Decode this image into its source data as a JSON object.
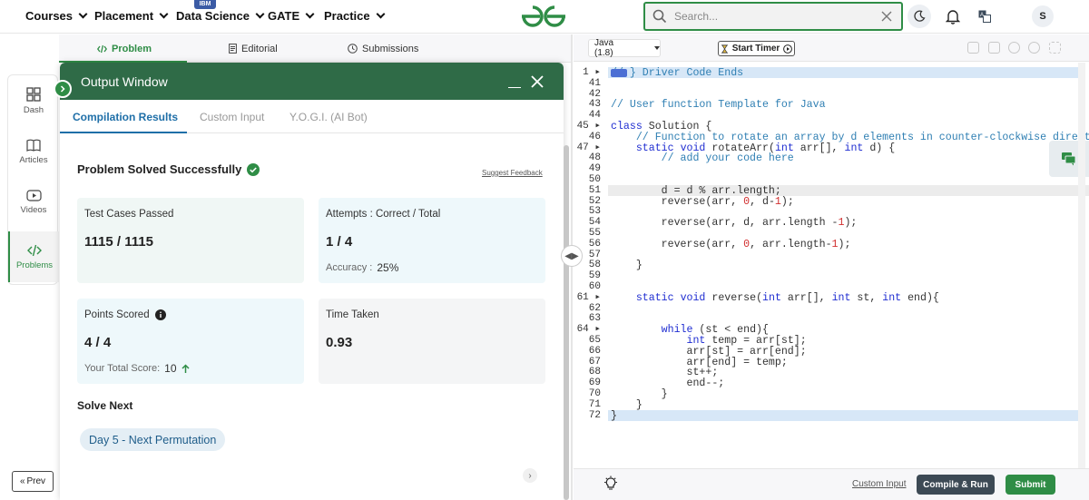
{
  "nav": {
    "items": [
      {
        "label": "Courses"
      },
      {
        "label": "Placement"
      },
      {
        "label": "Data Science"
      },
      {
        "label": "GATE"
      },
      {
        "label": "Practice"
      }
    ],
    "ibm_badge": "IBM",
    "search_placeholder": "Search...",
    "avatar": "S"
  },
  "rail": {
    "items": [
      {
        "label": "Dash",
        "icon": "dashboard-icon"
      },
      {
        "label": "Articles",
        "icon": "book-icon"
      },
      {
        "label": "Videos",
        "icon": "video-icon"
      },
      {
        "label": "Problems",
        "icon": "code-icon"
      }
    ],
    "prev": "Prev"
  },
  "problem_tabs": {
    "problem": "Problem",
    "editorial": "Editorial",
    "submissions": "Submissions"
  },
  "output": {
    "title": "Output Window",
    "tabs": [
      "Compilation Results",
      "Custom Input",
      "Y.O.G.I. (AI Bot)"
    ],
    "status": "Problem Solved Successfully",
    "suggest_feedback": "Suggest Feedback",
    "cards": {
      "tests_label": "Test Cases Passed",
      "tests_value": "1115 / 1115",
      "attempts_label": "Attempts : Correct / Total",
      "attempts_value": "1 / 4",
      "accuracy_label": "Accuracy :",
      "accuracy_value": "25%",
      "points_label": "Points Scored",
      "points_value": "4 / 4",
      "total_score_label": "Your Total Score:",
      "total_score_value": "10",
      "time_label": "Time Taken",
      "time_value": "0.93"
    },
    "solve_next": "Solve Next",
    "next_problem": "Day 5 - Next Permutation"
  },
  "editor": {
    "language": "Java (1.8)",
    "timer": "Start Timer",
    "custom_input": "Custom Input",
    "compile_run": "Compile & Run",
    "submit": "Submit",
    "line_numbers": [
      "1",
      "41",
      "42",
      "43",
      "44",
      "45",
      "46",
      "47",
      "48",
      "49",
      "50",
      "51",
      "52",
      "53",
      "54",
      "55",
      "56",
      "57",
      "58",
      "59",
      "60",
      "61",
      "62",
      "63",
      "64",
      "65",
      "66",
      "67",
      "68",
      "69",
      "70",
      "71",
      "72"
    ],
    "lines": [
      "// } Driver Code Ends",
      "",
      "",
      "// User function Template for Java",
      "",
      "class Solution {",
      "    // Function to rotate an array by d elements in counter-clockwise direction.",
      "    static void rotateArr(int arr[], int d) {",
      "        // add your code here",
      "",
      "",
      "        d = d % arr.length;",
      "        reverse(arr, 0, d-1);",
      "",
      "        reverse(arr, d, arr.length -1);",
      "",
      "        reverse(arr, 0, arr.length-1);",
      "",
      "    }",
      "",
      "",
      "    static void reverse(int arr[], int st, int end){",
      "",
      "",
      "        while (st < end){",
      "            int temp = arr[st];",
      "            arr[st] = arr[end];",
      "            arr[end] = temp;",
      "            st++;",
      "            end--;",
      "        }",
      "    }",
      "}"
    ]
  },
  "colors": {
    "brand_green": "#2f8d46",
    "header_green": "#2f6b47",
    "link_blue": "#1f6fa8",
    "compile_dark": "#3d4a55"
  }
}
